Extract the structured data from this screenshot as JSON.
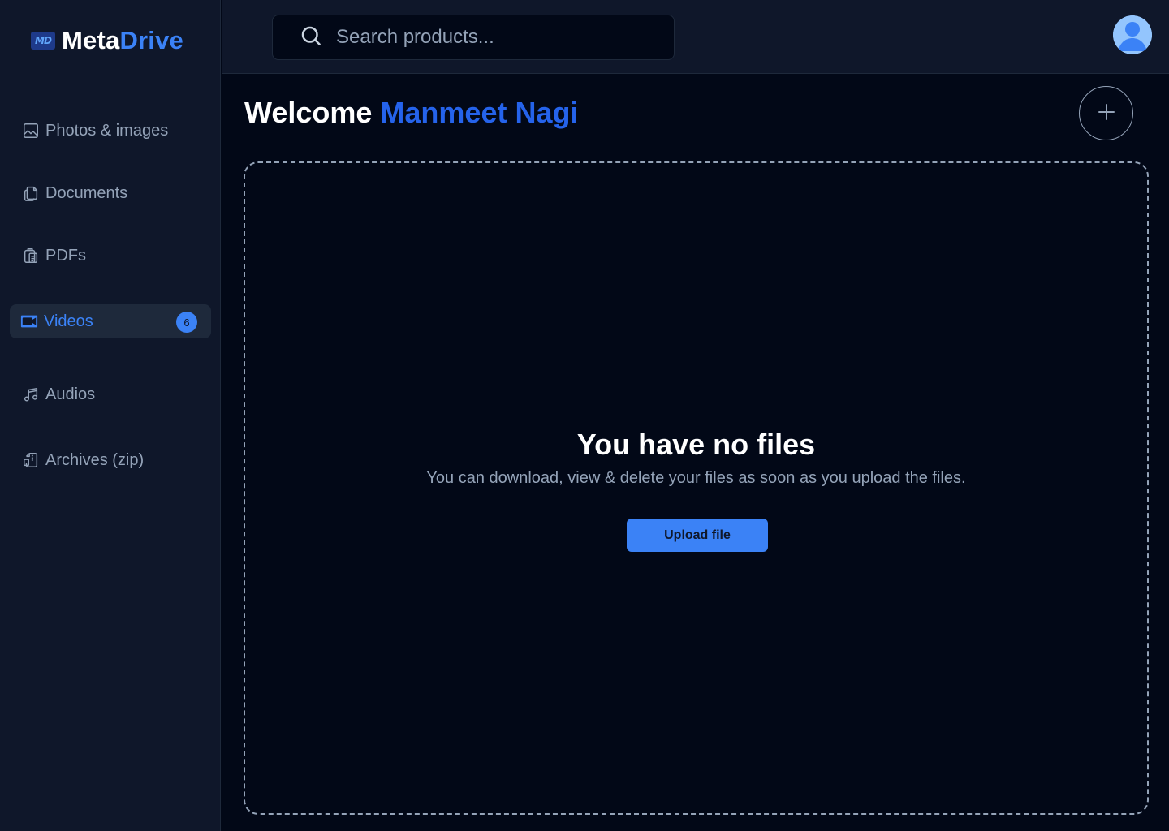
{
  "app": {
    "logo_mark": "MD",
    "name_part1": "Meta",
    "name_part2": "Drive",
    "accent_color": "#3b82f6"
  },
  "sidebar": {
    "items": [
      {
        "label": "Photos & images",
        "icon": "image-icon",
        "active": false
      },
      {
        "label": "Documents",
        "icon": "documents-icon",
        "active": false
      },
      {
        "label": "PDFs",
        "icon": "pdf-icon",
        "active": false
      },
      {
        "label": "Videos",
        "icon": "video-camera-icon",
        "active": true,
        "badge": "6"
      },
      {
        "label": "Audios",
        "icon": "music-note-icon",
        "active": false
      },
      {
        "label": "Archives (zip)",
        "icon": "archive-icon",
        "active": false
      }
    ]
  },
  "header": {
    "search_placeholder": "Search products...",
    "search_value": "",
    "avatar_icon": "user-avatar-icon"
  },
  "main": {
    "welcome_prefix": "Welcome",
    "user_name": "Manmeet Nagi",
    "add_icon": "plus-icon",
    "empty_title": "You have no files",
    "empty_subtitle": "You can download, view & delete your files as soon as you upload the files.",
    "upload_label": "Upload file"
  }
}
